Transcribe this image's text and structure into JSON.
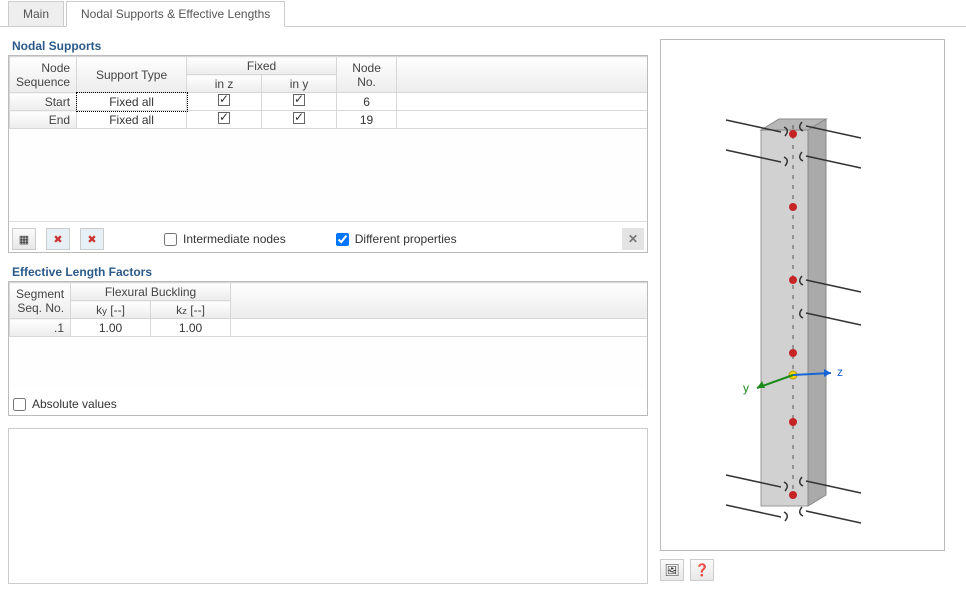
{
  "tabs": {
    "main": "Main",
    "nodal": "Nodal Supports & Effective Lengths"
  },
  "nodal_supports": {
    "title": "Nodal Supports",
    "headers": {
      "node_sequence_top": "Node",
      "node_sequence_bottom": "Sequence",
      "support_type": "Support Type",
      "fixed": "Fixed",
      "in_z": "in z",
      "in_y": "in y",
      "node_no_top": "Node",
      "node_no_bottom": "No."
    },
    "rows": [
      {
        "seq": "Start",
        "type": "Fixed all",
        "in_z": true,
        "in_y": true,
        "node_no": "6",
        "selected": true
      },
      {
        "seq": "End",
        "type": "Fixed all",
        "in_z": true,
        "in_y": true,
        "node_no": "19",
        "selected": false
      }
    ],
    "options": {
      "intermediate_nodes": {
        "label": "Intermediate nodes",
        "checked": false
      },
      "different_properties": {
        "label": "Different properties",
        "checked": true
      }
    }
  },
  "effective_lengths": {
    "title": "Effective Length Factors",
    "headers": {
      "segment_top": "Segment",
      "segment_bottom": "Seq. No.",
      "flexural": "Flexural Buckling",
      "ky": "k<span class='sub'>y</span> [--]",
      "kz": "k<span class='sub'>z</span> [--]"
    },
    "rows": [
      {
        "seq": ".1",
        "ky": "1.00",
        "kz": "1.00"
      }
    ],
    "absolute_values": {
      "label": "Absolute values",
      "checked": false
    }
  },
  "viewer": {
    "axis_y": "y",
    "axis_z": "z"
  },
  "icons": {
    "add": "▦",
    "del": "✖",
    "close": "✕",
    "image": "🖼",
    "help": "❓"
  }
}
